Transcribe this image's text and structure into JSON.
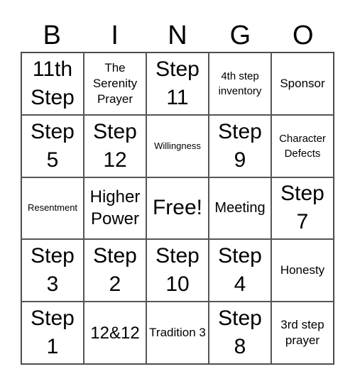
{
  "header": {
    "letters": [
      "B",
      "I",
      "N",
      "G",
      "O"
    ]
  },
  "cells": [
    [
      "11th Step",
      "The Serenity Prayer",
      "Step 11",
      "4th step inventory",
      "Sponsor"
    ],
    [
      "Step 5",
      "Step 12",
      "Willingness",
      "Step 9",
      "Character Defects"
    ],
    [
      "Resentment",
      "Higher Power",
      "Free!",
      "Meeting",
      "Step 7"
    ],
    [
      "Step 3",
      "Step 2",
      "Step 10",
      "Step 4",
      "Honesty"
    ],
    [
      "Step 1",
      "12&12",
      "Tradition 3",
      "Step 8",
      "3rd step prayer"
    ]
  ]
}
